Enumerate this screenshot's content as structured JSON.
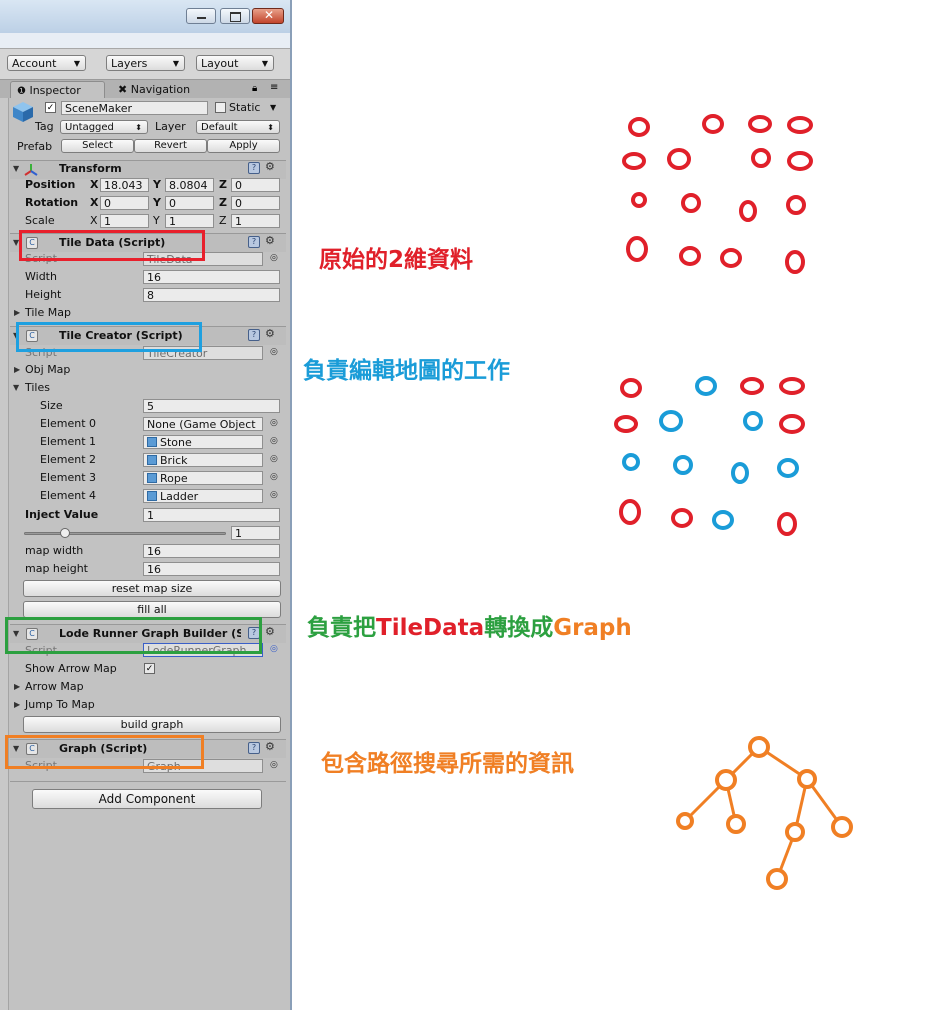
{
  "toolbar": {
    "account": "Account",
    "layers": "Layers",
    "layout": "Layout"
  },
  "tabs": {
    "inspector": "Inspector",
    "navigation": "Navigation"
  },
  "object": {
    "name": "SceneMaker",
    "static_label": "Static",
    "tag_label": "Tag",
    "tag_value": "Untagged",
    "layer_label": "Layer",
    "layer_value": "Default",
    "prefab_label": "Prefab",
    "select": "Select",
    "revert": "Revert",
    "apply": "Apply"
  },
  "transform": {
    "title": "Transform",
    "position_label": "Position",
    "rotation_label": "Rotation",
    "scale_label": "Scale",
    "position": {
      "x": "18.043",
      "y": "8.0804",
      "z": "0"
    },
    "rotation": {
      "x": "0",
      "y": "0",
      "z": "0"
    },
    "scale": {
      "x": "1",
      "y": "1",
      "z": "1"
    },
    "x": "X",
    "y": "Y",
    "z": "Z"
  },
  "tile_data": {
    "title": "Tile Data (Script)",
    "script_label": "Script",
    "script_value": "TileData",
    "width_label": "Width",
    "width_value": "16",
    "height_label": "Height",
    "height_value": "8",
    "tilemap_label": "Tile Map"
  },
  "tile_creator": {
    "title": "Tile Creator (Script)",
    "script_label": "Script",
    "script_value": "TileCreator",
    "objmap_label": "Obj Map",
    "tiles_label": "Tiles",
    "size_label": "Size",
    "size_value": "5",
    "elements": [
      {
        "label": "Element 0",
        "value": "None (Game Object"
      },
      {
        "label": "Element 1",
        "value": "Stone"
      },
      {
        "label": "Element 2",
        "value": "Brick"
      },
      {
        "label": "Element 3",
        "value": "Rope"
      },
      {
        "label": "Element 4",
        "value": "Ladder"
      }
    ],
    "inject_label": "Inject Value",
    "inject_value": "1",
    "slider_value": "1",
    "mapwidth_label": "map width",
    "mapwidth_value": "16",
    "mapheight_label": "map height",
    "mapheight_value": "16",
    "reset_button": "reset map size",
    "fill_button": "fill all"
  },
  "graph_builder": {
    "title": "Lode Runner Graph Builder (S",
    "script_label": "Script",
    "script_value": "LodeRunnerGraph",
    "show_arrow_label": "Show Arrow Map",
    "arrow_map_label": "Arrow Map",
    "jump_label": "Jump To Map",
    "build_button": "build graph"
  },
  "graph": {
    "title": "Graph (Script)",
    "script_label": "Script",
    "script_value": "Graph"
  },
  "add_component": "Add Component",
  "annotations": {
    "red": "原始的2維資料",
    "blue": "負責編輯地圖的工作",
    "green_a": "負責把",
    "green_b": "TileData",
    "green_c": "轉換成",
    "green_d": "Graph",
    "orange": "包含路徑搜尋所需的資訊"
  },
  "colors": {
    "red": "#e0202a",
    "blue": "#1a9cd8",
    "green": "#2ca040",
    "orange": "#f07f24",
    "tile_data_red": "#e8202c",
    "creator_blue": "#1ea0e0"
  }
}
